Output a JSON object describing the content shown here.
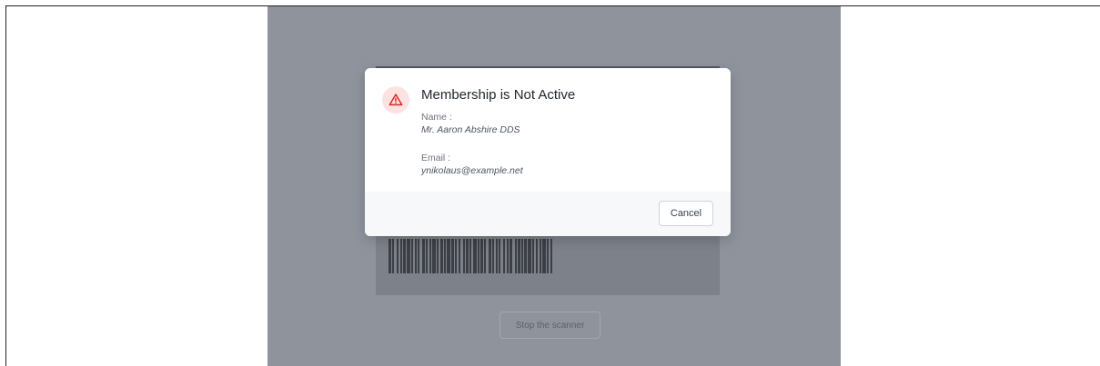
{
  "scanner": {
    "stop_label": "Stop the scanner"
  },
  "dialog": {
    "icon": "warning-triangle-icon",
    "title": "Membership is Not Active",
    "name_label": "Name :",
    "name_value": "Mr. Aaron Abshire DDS",
    "email_label": "Email :",
    "email_value": "ynikolaus@example.net",
    "cancel_label": "Cancel"
  },
  "colors": {
    "overlay": "#8f939c",
    "warning_icon": "#dc2626",
    "warning_bg": "#fde2e2"
  }
}
